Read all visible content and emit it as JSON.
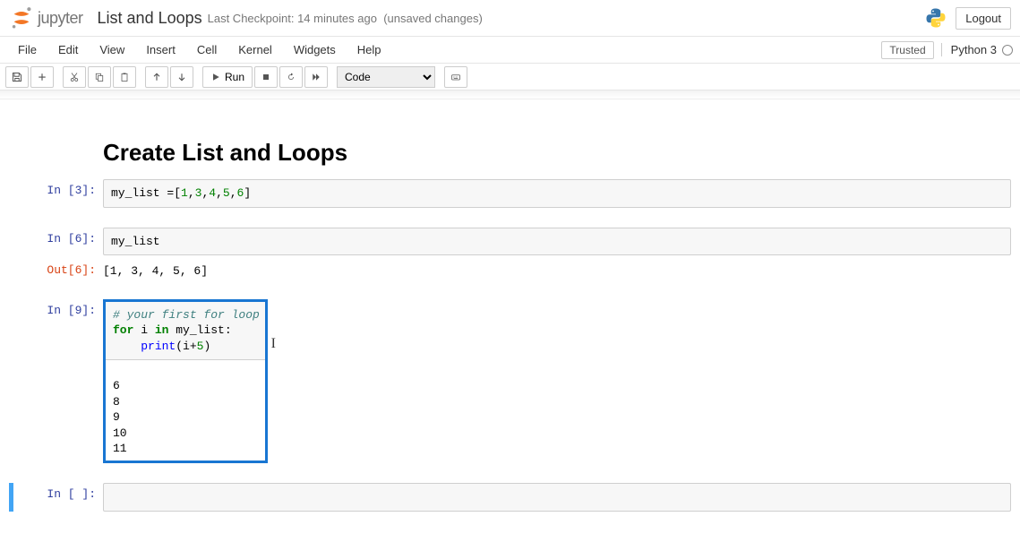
{
  "header": {
    "logo_text": "jupyter",
    "notebook_title": "List and Loops",
    "checkpoint": "Last Checkpoint: 14 minutes ago",
    "unsaved": "(unsaved changes)",
    "logout": "Logout"
  },
  "menubar": {
    "items": [
      "File",
      "Edit",
      "View",
      "Insert",
      "Cell",
      "Kernel",
      "Widgets",
      "Help"
    ],
    "trusted": "Trusted",
    "kernel": "Python 3"
  },
  "toolbar": {
    "run_label": "Run",
    "celltype": "Code"
  },
  "cells": {
    "md_title": "Create List and Loops",
    "c1": {
      "prompt": "In [3]:",
      "code_plain": "my_list =[1,3,4,5,6]"
    },
    "c2": {
      "prompt": "In [6]:",
      "code_plain": "my_list",
      "out_prompt": "Out[6]:",
      "out": "[1, 3, 4, 5, 6]"
    },
    "c3": {
      "prompt": "In [9]:",
      "comment": "# your first for loop",
      "line2_for": "for",
      "line2_i": " i ",
      "line2_in": "in",
      "line2_rest": " my_list:",
      "line3_indent": "    ",
      "line3_fn": "print",
      "line3_open": "(i+",
      "line3_num": "5",
      "line3_close": ")",
      "output": "6\n8\n9\n10\n11"
    },
    "c4": {
      "prompt": "In [ ]:"
    }
  }
}
